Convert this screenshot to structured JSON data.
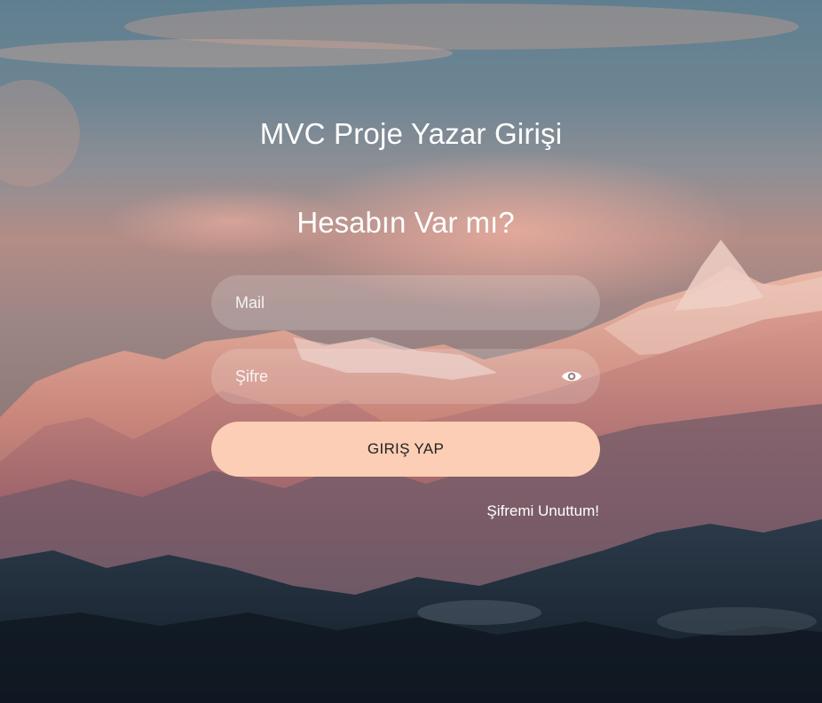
{
  "page": {
    "title": "MVC Proje Yazar Girişi",
    "subtitle": "Hesabın Var mı?"
  },
  "form": {
    "mail_placeholder": "Mail",
    "password_placeholder": "Şifre",
    "submit_label": "GIRIŞ YAP",
    "forgot_label": "Şifremi Unuttum!"
  },
  "icons": {
    "password_toggle": "eye-icon"
  },
  "colors": {
    "button_bg": "#fbceb5",
    "button_text": "#222222",
    "text": "#ffffff"
  }
}
